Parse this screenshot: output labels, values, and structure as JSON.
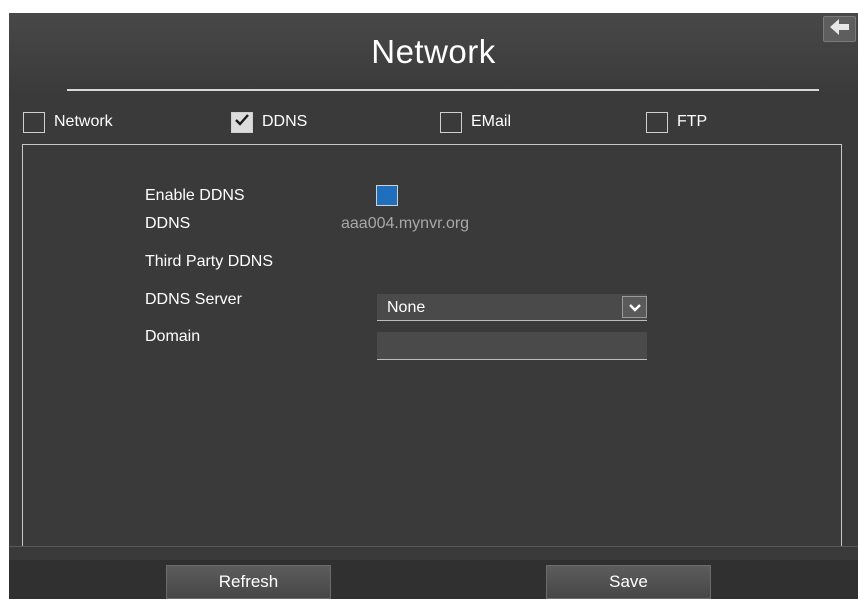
{
  "window": {
    "title": "Network"
  },
  "tabs": [
    {
      "label": "Network",
      "checked": false
    },
    {
      "label": "DDNS",
      "checked": true
    },
    {
      "label": "EMail",
      "checked": false
    },
    {
      "label": "FTP",
      "checked": false
    }
  ],
  "form": {
    "enable_ddns_label": "Enable DDNS",
    "enable_ddns_checked": true,
    "ddns_label": "DDNS",
    "ddns_value": "aaa004.mynvr.org",
    "third_party_label": "Third Party DDNS",
    "server_label": "DDNS Server",
    "server_selected": "None",
    "domain_label": "Domain",
    "domain_value": ""
  },
  "footer": {
    "refresh_label": "Refresh",
    "save_label": "Save"
  },
  "icons": {
    "back": "back-arrow-icon",
    "checkmark": "checkmark-icon",
    "dropdown": "chevron-down-icon"
  },
  "colors": {
    "background": "#3a3a3a",
    "enable_checkbox": "#1f6fbd",
    "muted_text": "#a8a8a8"
  }
}
